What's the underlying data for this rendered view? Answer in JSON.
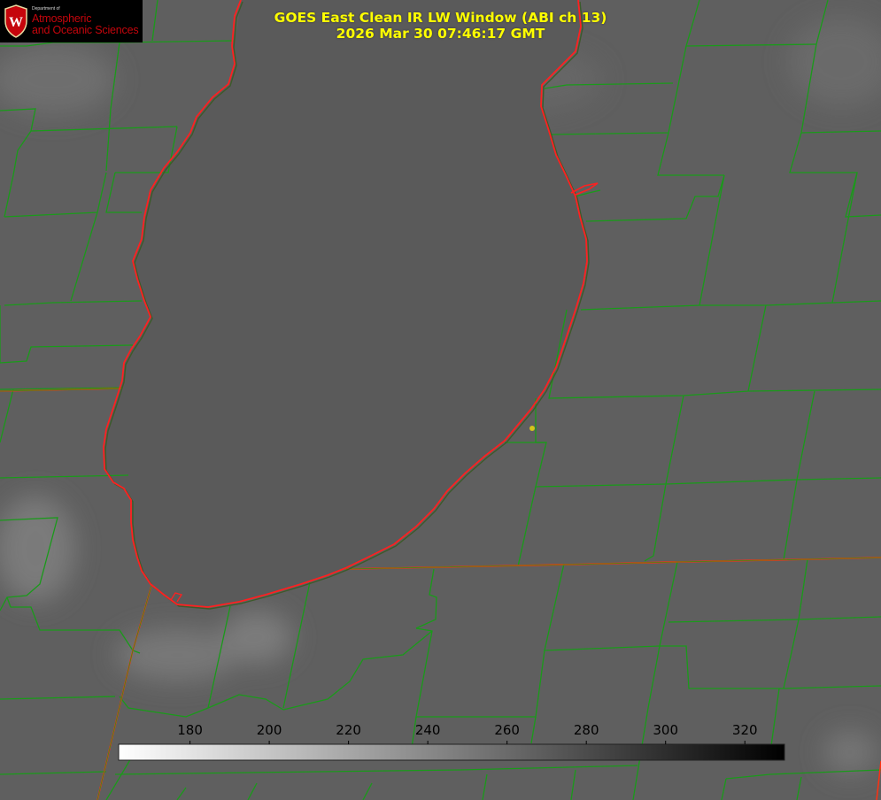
{
  "logo": {
    "department": "Department of",
    "line1": "Atmospheric",
    "line2": "and Oceanic Sciences",
    "initial": "W"
  },
  "title": {
    "line1": "GOES East Clean IR LW Window (ABI ch 13)",
    "line2": "2026 Mar 30 07:46:17 GMT"
  },
  "colorbar": {
    "ticks": [
      "180",
      "200",
      "220",
      "240",
      "260",
      "280",
      "300",
      "320"
    ],
    "min": 162,
    "max": 330,
    "tick_values": [
      180,
      200,
      220,
      240,
      260,
      280,
      300,
      320
    ],
    "start_color": "#ffffff",
    "end_color": "#000000"
  },
  "colors": {
    "county_lines": "#1a9a1a",
    "lake_shore": "#ff2020",
    "state_line": "#ff3010",
    "title_text": "#ffff00",
    "marker": "#d4c41a"
  }
}
